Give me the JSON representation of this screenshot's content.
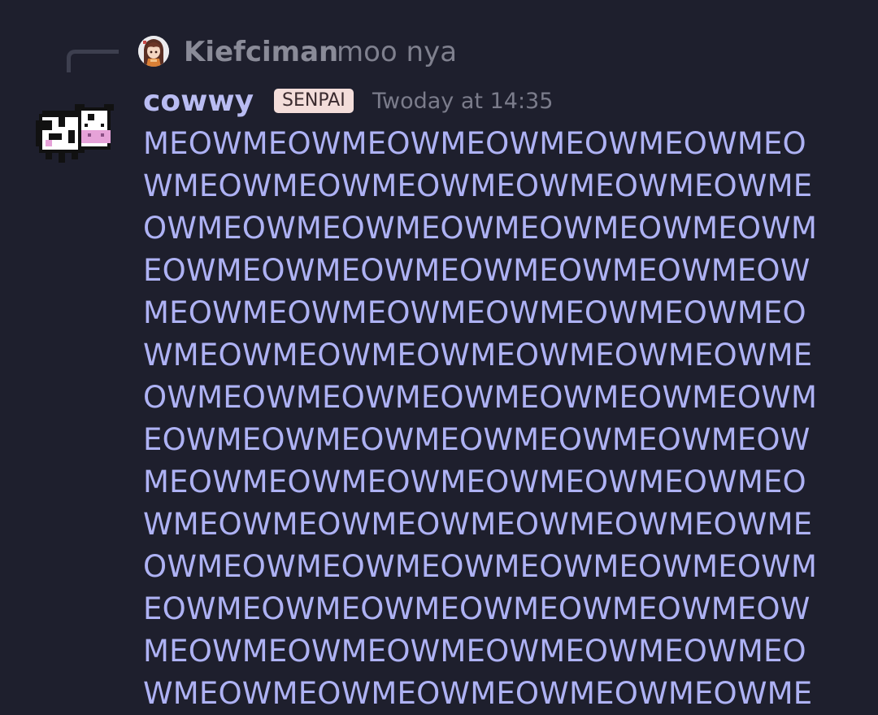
{
  "reply": {
    "author": "Kiefciman",
    "text": "moo nya",
    "avatar_icon": "anime-girl-avatar-icon"
  },
  "message": {
    "author": "cowwy",
    "badge": "SENPAI",
    "timestamp": "Twoday at 14:35",
    "avatar_icon": "pixel-cow-avatar-icon",
    "lines": [
      "MEOWMEOWMEOWMEOWMEOWMEOWMEO",
      "WMEOWMEOWMEOWMEOWMEOWMEOWME",
      "OWMEOWMEOWMEOWMEOWMEOWMEOWM",
      "EOWMEOWMEOWMEOWMEOWMEOWMEOW",
      "MEOWMEOWMEOWMEOWMEOWMEOWMEO",
      "WMEOWMEOWMEOWMEOWMEOWMEOWME",
      "OWMEOWMEOWMEOWMEOWMEOWMEOWM",
      "EOWMEOWMEOWMEOWMEOWMEOWMEOW",
      "MEOWMEOWMEOWMEOWMEOWMEOWMEO",
      "WMEOWMEOWMEOWMEOWMEOWMEOWME",
      "OWMEOWMEOWMEOWMEOWMEOWMEOWM",
      "EOWMEOWMEOWMEOWMEOWMEOWMEOW",
      "MEOWMEOWMEOWMEOWMEOWMEOWMEO",
      "WMEOWMEOWMEOWMEOWMEOWMEOWME"
    ]
  },
  "colors": {
    "background": "#1e1f2d",
    "username": "#b9bcf2",
    "message_text": "#aeb2f4",
    "badge_bg": "#f3ddda",
    "muted_text": "#7b7c8b"
  }
}
